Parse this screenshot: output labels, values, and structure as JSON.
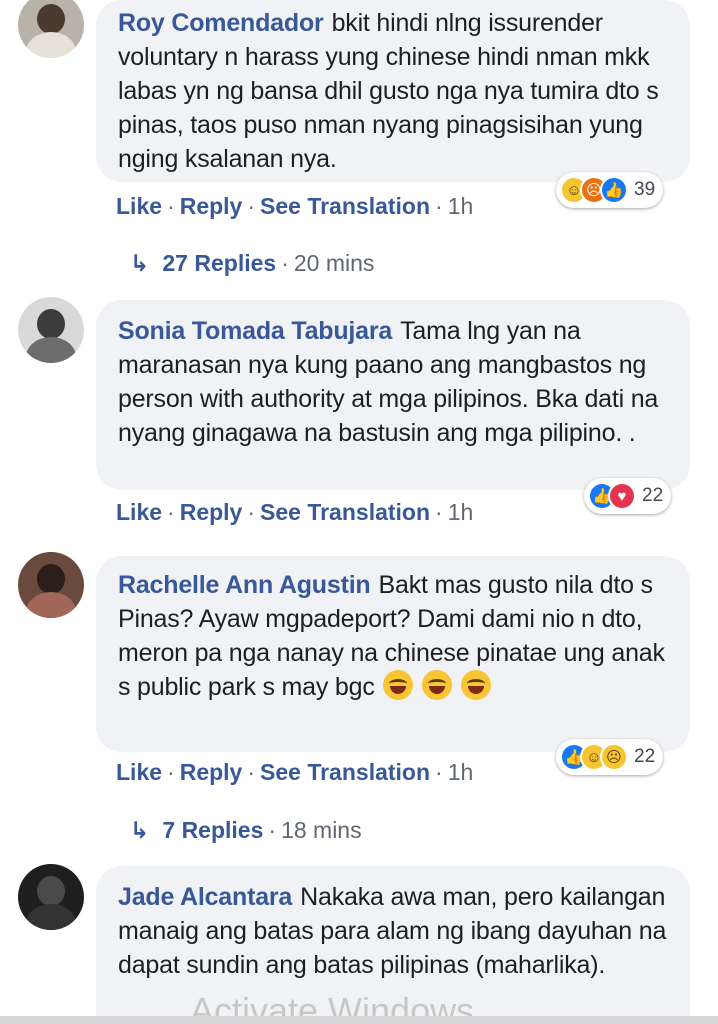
{
  "actions": {
    "like": "Like",
    "reply": "Reply",
    "see_translation": "See Translation",
    "separator": "·"
  },
  "comments": [
    {
      "author": "Roy Comendador",
      "text": "bkit hindi nlng issurender voluntary n harass yung chinese hindi nman mkk labas yn ng bansa dhil gusto nga nya tumira dto s pinas, taos puso nman nyang pinagsisihan yung nging ksalanan nya.",
      "time": "1h",
      "reaction_icons": [
        "haha-icon",
        "angry-icon",
        "like-icon"
      ],
      "reaction_count": "39",
      "replies": {
        "label": "27 Replies",
        "time": "20 mins"
      }
    },
    {
      "author": "Sonia Tomada Tabujara",
      "text": "Tama lng yan na maranasan nya kung paano ang mangbastos ng person with authority at mga pilipinos. Bka dati na nyang ginagawa na bastusin ang mga pilipino. .",
      "time": "1h",
      "reaction_icons": [
        "like-icon",
        "love-icon"
      ],
      "reaction_count": "22"
    },
    {
      "author": "Rachelle Ann Agustin",
      "text": "Bakt mas gusto nila dto s Pinas? Ayaw mgpadeport? Dami dami nio n dto, meron pa nga nanay na chinese pinatae ung anak s public park s may bgc",
      "time": "1h",
      "reaction_icons": [
        "like-icon",
        "haha-icon",
        "sad-icon"
      ],
      "reaction_count": "22",
      "replies": {
        "label": "7 Replies",
        "time": "18 mins"
      }
    },
    {
      "author": "Jade Alcantara",
      "text": "Nakaka awa man, pero kailangan manaig ang batas para alam ng ibang dayuhan na dapat sundin ang batas pilipinas (maharlika)."
    }
  ],
  "watermark": "Activate Windows",
  "colors": {
    "author": "#385898",
    "bubble": "#f0f2f5",
    "like": "#1877f2",
    "love": "#e4344f",
    "haha": "#f7c531",
    "angry": "#e9710f"
  }
}
